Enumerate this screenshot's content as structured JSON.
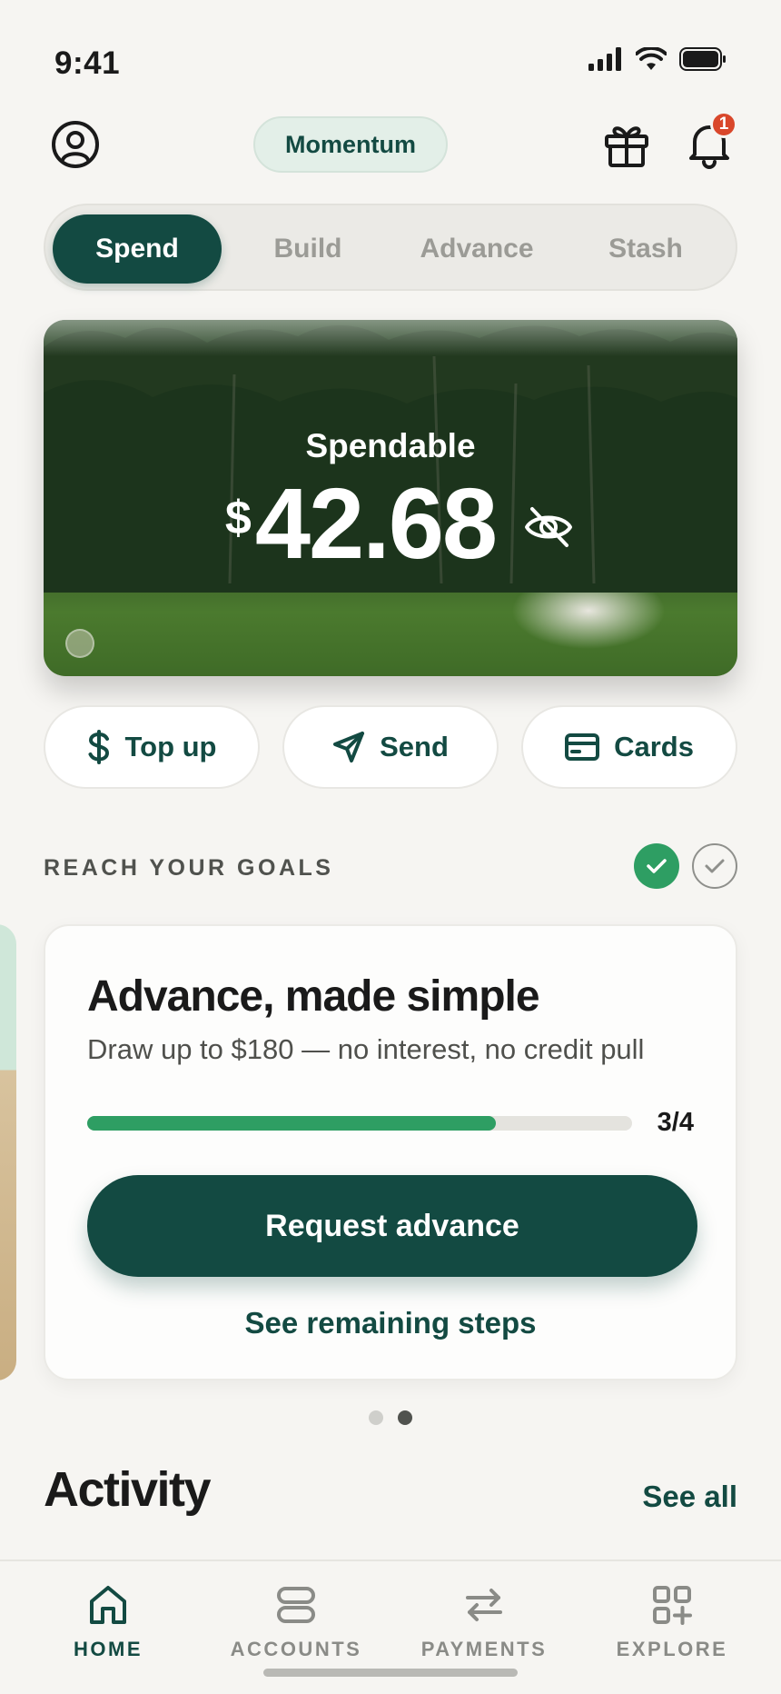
{
  "status_bar": {
    "time": "9:41"
  },
  "header": {
    "brand": "Momentum",
    "notification_count": "1"
  },
  "tabs": [
    {
      "label": "Spend",
      "active": true
    },
    {
      "label": "Build",
      "active": false
    },
    {
      "label": "Advance",
      "active": false
    },
    {
      "label": "Stash",
      "active": false
    }
  ],
  "balance_card": {
    "label": "Spendable",
    "currency": "$",
    "amount": "42.68"
  },
  "actions": [
    {
      "label": "Top up",
      "icon": "dollar-icon"
    },
    {
      "label": "Send",
      "icon": "send-icon"
    },
    {
      "label": "Cards",
      "icon": "card-icon"
    }
  ],
  "goals": {
    "section_title": "REACH YOUR GOALS",
    "card": {
      "title": "Advance, made simple",
      "subtitle": "Draw up to $180 — no interest, no credit pull",
      "progress": 0.75,
      "progress_label": "3/4",
      "primary_cta": "Request advance",
      "secondary_link": "See remaining steps"
    },
    "pager": {
      "count": 2,
      "active_index": 1
    }
  },
  "activity": {
    "title": "Activity",
    "see_all": "See all"
  },
  "bottom_nav": [
    {
      "label": "HOME",
      "icon": "home-icon",
      "active": true
    },
    {
      "label": "ACCOUNTS",
      "icon": "accounts-icon",
      "active": false
    },
    {
      "label": "PAYMENTS",
      "icon": "transfer-icon",
      "active": false
    },
    {
      "label": "EXPLORE",
      "icon": "grid-plus-icon",
      "active": false
    }
  ],
  "colors": {
    "brand": "#134a42",
    "success": "#2e9e63",
    "badge": "#d9472b",
    "background": "#f6f5f2"
  }
}
